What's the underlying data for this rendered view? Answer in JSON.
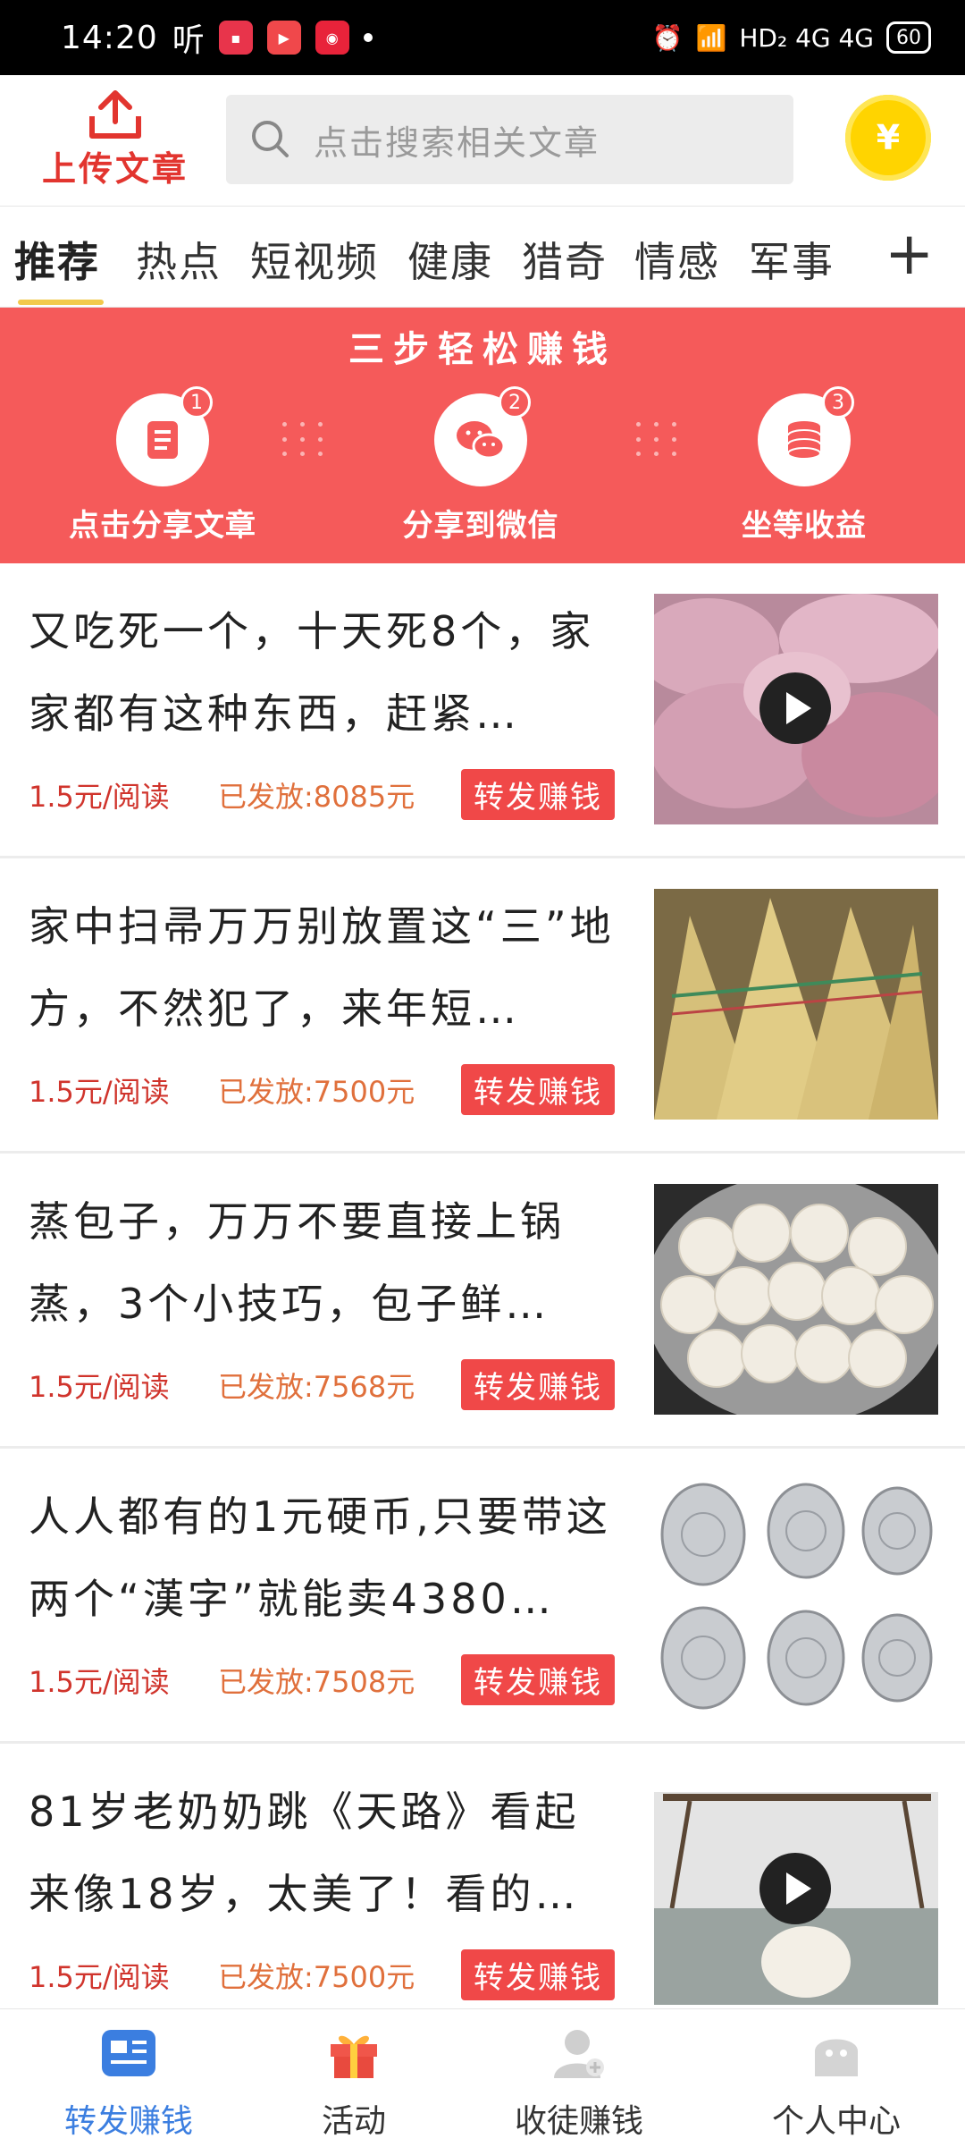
{
  "status_bar": {
    "time": "14:20",
    "ting": "听",
    "network": "HD₂ 4G 4G",
    "battery": "60"
  },
  "header": {
    "upload_label": "上传文章",
    "search_placeholder": "点击搜索相关文章",
    "coin_symbol": "¥"
  },
  "tabs": [
    "推荐",
    "热点",
    "短视频",
    "健康",
    "猎奇",
    "情感",
    "军事"
  ],
  "active_tab": "推荐",
  "banner": {
    "title": "三步轻松赚钱",
    "steps": [
      {
        "num": "1",
        "label": "点击分享文章"
      },
      {
        "num": "2",
        "label": "分享到微信"
      },
      {
        "num": "3",
        "label": "坐等收益"
      }
    ]
  },
  "articles": [
    {
      "title": "又吃死一个，十天死8个，家家都有这种东西，赶紧…",
      "price": "1.5元/阅读",
      "issued": "已发放:8085元",
      "action": "转发赚钱",
      "video": true
    },
    {
      "title": "家中扫帚万万别放置这“三”地方，不然犯了，来年短…",
      "price": "1.5元/阅读",
      "issued": "已发放:7500元",
      "action": "转发赚钱",
      "video": false
    },
    {
      "title": "蒸包子，万万不要直接上锅蒸，3个小技巧，包子鲜…",
      "price": "1.5元/阅读",
      "issued": "已发放:7568元",
      "action": "转发赚钱",
      "video": false
    },
    {
      "title": "人人都有的1元硬币,只要带这两个“漢字”就能卖4380…",
      "price": "1.5元/阅读",
      "issued": "已发放:7508元",
      "action": "转发赚钱",
      "video": false
    },
    {
      "title": "81岁老奶奶跳《天路》看起来像18岁，太美了！看的…",
      "price": "1.5元/阅读",
      "issued": "已发放:7500元",
      "action": "转发赚钱",
      "video": true
    }
  ],
  "bottom_nav": [
    "转发赚钱",
    "活动",
    "收徒赚钱",
    "个人中心"
  ],
  "colors": {
    "accent_red": "#f55a5a",
    "nav_active": "#3b7ee0",
    "coin": "#ffd400"
  }
}
